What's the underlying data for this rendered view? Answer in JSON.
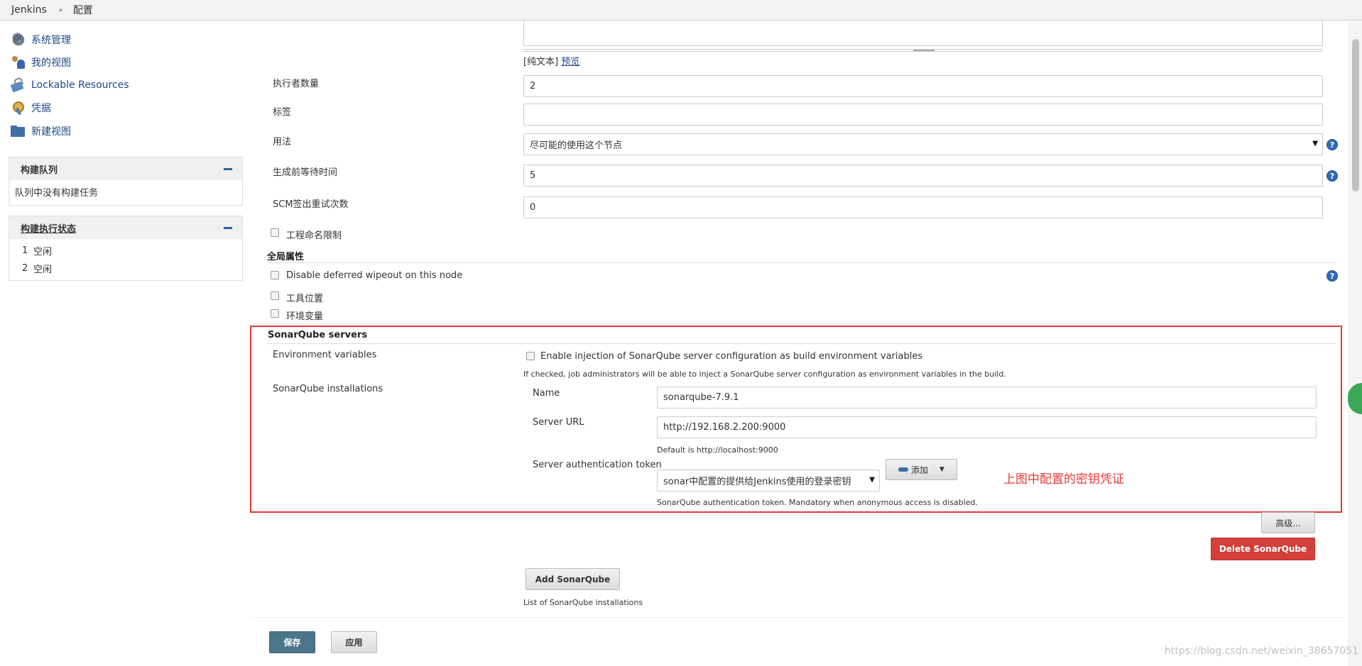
{
  "breadcrumb": {
    "root": "Jenkins",
    "current": "配置"
  },
  "sidebar": {
    "items": [
      {
        "label": "系统管理",
        "icon": "gear-icon"
      },
      {
        "label": "我的视图",
        "icon": "people-icon"
      },
      {
        "label": "Lockable Resources",
        "icon": "lock-icon"
      },
      {
        "label": "凭据",
        "icon": "key-icon"
      },
      {
        "label": "新建视图",
        "icon": "folder-icon"
      }
    ],
    "queue": {
      "title": "构建队列",
      "empty_text": "队列中没有构建任务"
    },
    "executors": {
      "title": "构建执行状态",
      "rows": [
        {
          "num": "1",
          "status": "空闲"
        },
        {
          "num": "2",
          "status": "空闲"
        }
      ]
    }
  },
  "form": {
    "text_links": {
      "plain": "[纯文本]",
      "preview": "预览"
    },
    "executors_label": "执行者数量",
    "executors_value": "2",
    "labels_label": "标签",
    "labels_value": "",
    "usage_label": "用法",
    "usage_value": "尽可能的使用这个节点",
    "quiet_period_label": "生成前等待时间",
    "quiet_period_value": "5",
    "scm_retry_label": "SCM签出重试次数",
    "scm_retry_value": "0",
    "restrict_names_label": "工程命名限制",
    "global_props_title": "全局属性",
    "disable_wipeout_label": "Disable deferred wipeout on this node",
    "tool_locations_label": "工具位置",
    "env_vars_label": "环境变量"
  },
  "sonar": {
    "section_title": "SonarQube servers",
    "env_vars_label": "Environment variables",
    "env_injection_label": "Enable injection of SonarQube server configuration as build environment variables",
    "env_injection_help": "If checked, job administrators will be able to inject a SonarQube server configuration as environment variables in the build.",
    "installations_label": "SonarQube installations",
    "name_label": "Name",
    "name_value": "sonarqube-7.9.1",
    "url_label": "Server URL",
    "url_value": "http://192.168.2.200:9000",
    "url_default": "Default is http://localhost:9000",
    "token_label": "Server authentication token",
    "token_value": "sonar中配置的提供给Jenkins使用的登录密钥",
    "add_button": "添加",
    "token_help": "SonarQube authentication token. Mandatory when anonymous access is disabled.",
    "advanced_button": "高级...",
    "delete_button": "Delete SonarQube",
    "add_sonar_button": "Add SonarQube",
    "list_help": "List of SonarQube installations"
  },
  "annotation": "上图中配置的密钥凭证",
  "footer": {
    "save": "保存",
    "apply": "应用"
  },
  "watermark": "https://blog.csdn.net/weixin_38657051",
  "colors": {
    "red_highlight": "#e53935",
    "jenkins_blue": "#204a87",
    "delete_red": "#d43f3a"
  }
}
